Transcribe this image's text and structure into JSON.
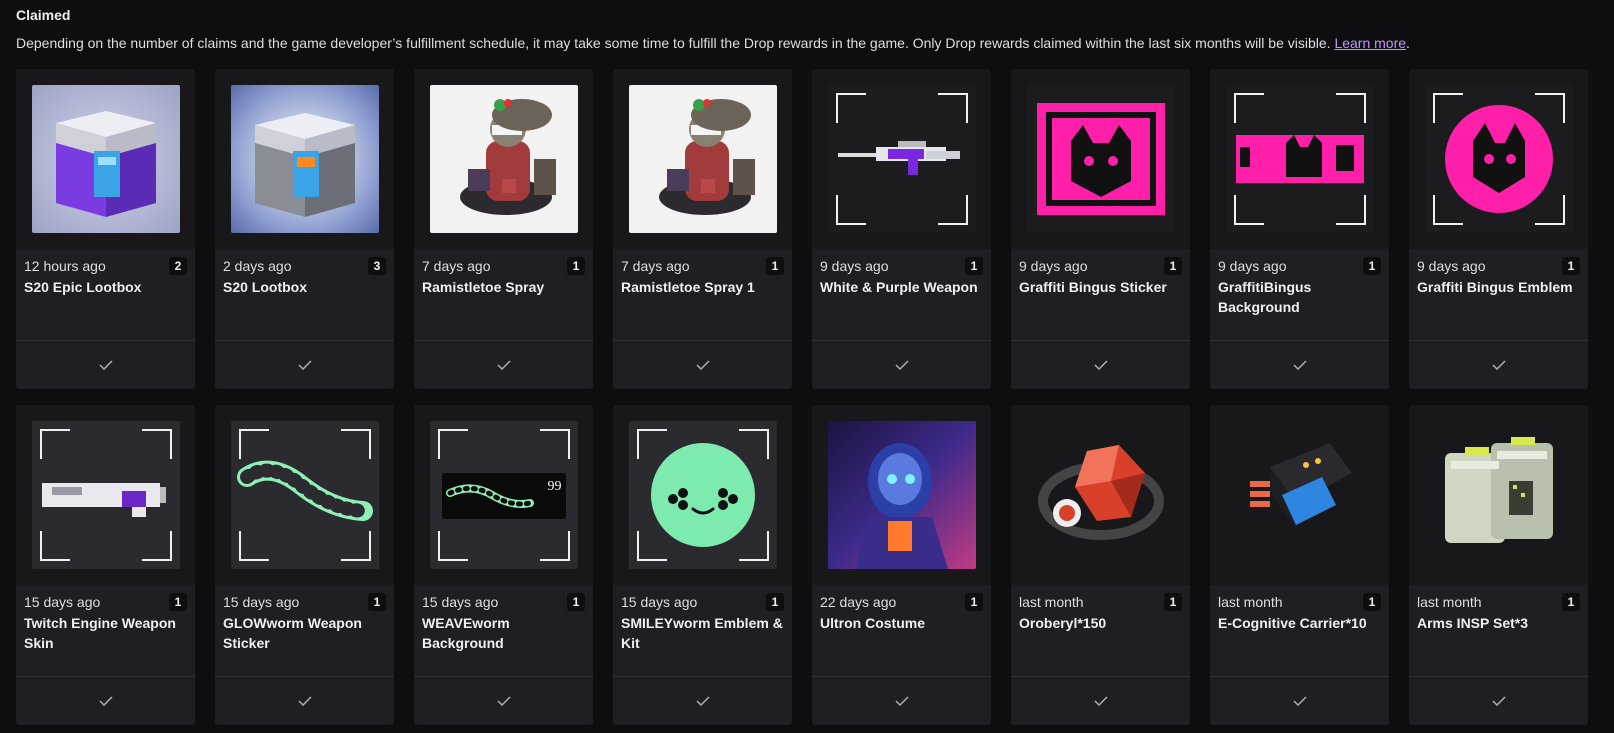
{
  "header": {
    "title": "Claimed",
    "description": "Depending on the number of claims and the game developer’s fulfillment schedule, it may take some time to fulfill the Drop rewards in the game. Only Drop rewards claimed within the last six months will be visible. ",
    "learn_more": "Learn more",
    "period": "."
  },
  "colors": {
    "accent": "#bf94ff",
    "background": "#0e0e10",
    "card": "#1f1f23"
  },
  "cards": [
    {
      "time": "12 hours ago",
      "qty": "2",
      "name": "S20 Epic Lootbox",
      "icon": "epic-lootbox-icon"
    },
    {
      "time": "2 days ago",
      "qty": "3",
      "name": "S20 Lootbox",
      "icon": "lootbox-icon"
    },
    {
      "time": "7 days ago",
      "qty": "1",
      "name": "Ramistletoe Spray",
      "icon": "spray-icon"
    },
    {
      "time": "7 days ago",
      "qty": "1",
      "name": "Ramistletoe Spray 1",
      "icon": "spray-icon"
    },
    {
      "time": "9 days ago",
      "qty": "1",
      "name": "White & Purple Weapon",
      "icon": "weapon-icon"
    },
    {
      "time": "9 days ago",
      "qty": "1",
      "name": "Graffiti Bingus Sticker",
      "icon": "sticker-icon"
    },
    {
      "time": "9 days ago",
      "qty": "1",
      "name": "GraffitiBingus Background",
      "icon": "background-icon"
    },
    {
      "time": "9 days ago",
      "qty": "1",
      "name": "Graffiti Bingus Emblem",
      "icon": "emblem-icon"
    },
    {
      "time": "15 days ago",
      "qty": "1",
      "name": "Twitch Engine Weapon Skin",
      "icon": "weapon-skin-icon"
    },
    {
      "time": "15 days ago",
      "qty": "1",
      "name": "GLOWworm Weapon Sticker",
      "icon": "worm-sticker-icon"
    },
    {
      "time": "15 days ago",
      "qty": "1",
      "name": "WEAVEworm Background",
      "icon": "worm-background-icon",
      "badge": "99"
    },
    {
      "time": "15 days ago",
      "qty": "1",
      "name": "SMILEYworm Emblem & Kit",
      "icon": "smiley-emblem-icon"
    },
    {
      "time": "22 days ago",
      "qty": "1",
      "name": "Ultron Costume",
      "icon": "costume-icon"
    },
    {
      "time": "last month",
      "qty": "1",
      "name": "Oroberyl*150",
      "icon": "crystal-icon"
    },
    {
      "time": "last month",
      "qty": "1",
      "name": "E-Cognitive Carrier*10",
      "icon": "carrier-icon"
    },
    {
      "time": "last month",
      "qty": "1",
      "name": "Arms INSP Set*3",
      "icon": "arms-set-icon"
    }
  ]
}
